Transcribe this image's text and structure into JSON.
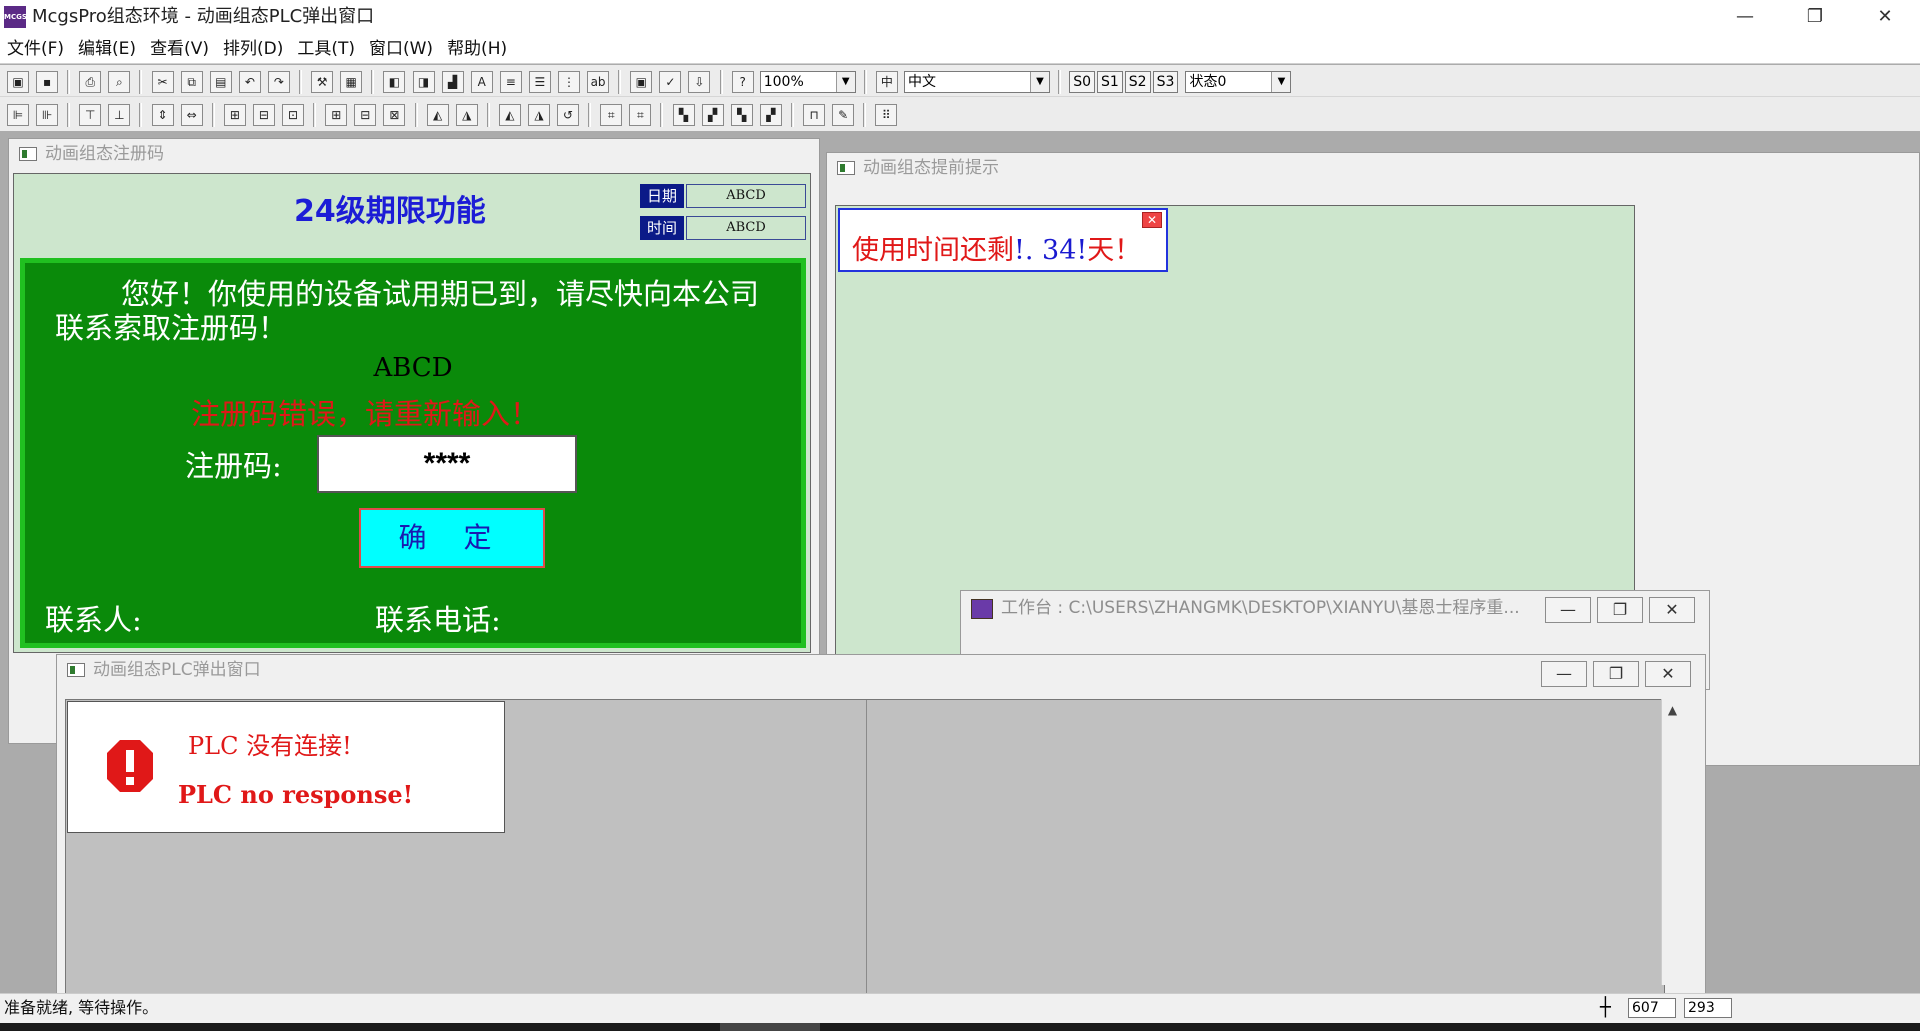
{
  "window": {
    "title": "McgsPro组态环境 - 动画组态PLC弹出窗口",
    "icon_text": "MCGS",
    "controls": [
      "—",
      "❐",
      "✕"
    ]
  },
  "menu": [
    "文件(F)",
    "编辑(E)",
    "查看(V)",
    "排列(D)",
    "工具(T)",
    "窗口(W)",
    "帮助(H)"
  ],
  "toolbar": {
    "zoom": "100%",
    "language": "中文",
    "states": [
      "S0",
      "S1",
      "S2",
      "S3"
    ],
    "state_select": "状态0"
  },
  "register_window": {
    "title": "动画组态注册码",
    "heading": "24级期限功能",
    "date_label": "日期",
    "date_value": "ABCD",
    "time_label": "时间",
    "time_value": "ABCD",
    "notice": "您好！你使用的设备试用期已到，请尽快向本公司联系索取注册码！",
    "code_display": "ABCD",
    "error": "注册码错误，请重新输入！",
    "reg_label": "注册码:",
    "reg_value": "****",
    "ok_button": "确 定",
    "contact_label": "联系人:",
    "phone_label": "联系电话:"
  },
  "reminder_window": {
    "title": "动画组态提前提示",
    "text_prefix": "使用时间还剩",
    "days": "!. 34!",
    "text_suffix": "天！"
  },
  "workspace_window": {
    "title": "工作台 : C:\\USERS\\ZHANGMK\\DESKTOP\\XIANYU\\基恩士程序重..."
  },
  "popup_window": {
    "title": "动画组态PLC弹出窗口",
    "plc_cn": "PLC 没有连接!",
    "plc_en": "PLC no response!"
  },
  "statusbar": {
    "text": "准备就绪, 等待操作。",
    "x": "607",
    "y": "293"
  },
  "colors": {
    "heading": "#1c1cd6",
    "panel_green": "#0a8a0a",
    "canvas_green": "#cde6cd",
    "error_red": "#e01818",
    "button_cyan": "#00ffff"
  }
}
